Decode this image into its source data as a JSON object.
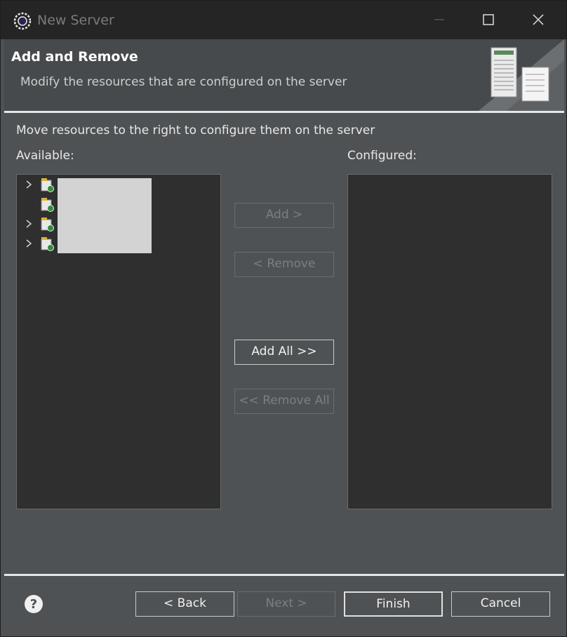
{
  "window": {
    "title": "New Server"
  },
  "banner": {
    "title": "Add and Remove",
    "description": "Modify the resources that are configured on the server"
  },
  "body": {
    "instruction": "Move resources to the right to configure them on the server",
    "available_label": "Available:",
    "configured_label": "Configured:"
  },
  "available_items": [
    {
      "expandable": true
    },
    {
      "expandable": false
    },
    {
      "expandable": true
    },
    {
      "expandable": true
    }
  ],
  "buttons": {
    "add": "Add >",
    "remove": "< Remove",
    "add_all": "Add All >>",
    "remove_all": "<< Remove All"
  },
  "footer": {
    "back": "< Back",
    "next": "Next >",
    "finish": "Finish",
    "cancel": "Cancel"
  },
  "icons": {
    "app": "eclipse-icon",
    "server_banner": "server-icon",
    "project": "project-icon",
    "help": "help-icon"
  }
}
